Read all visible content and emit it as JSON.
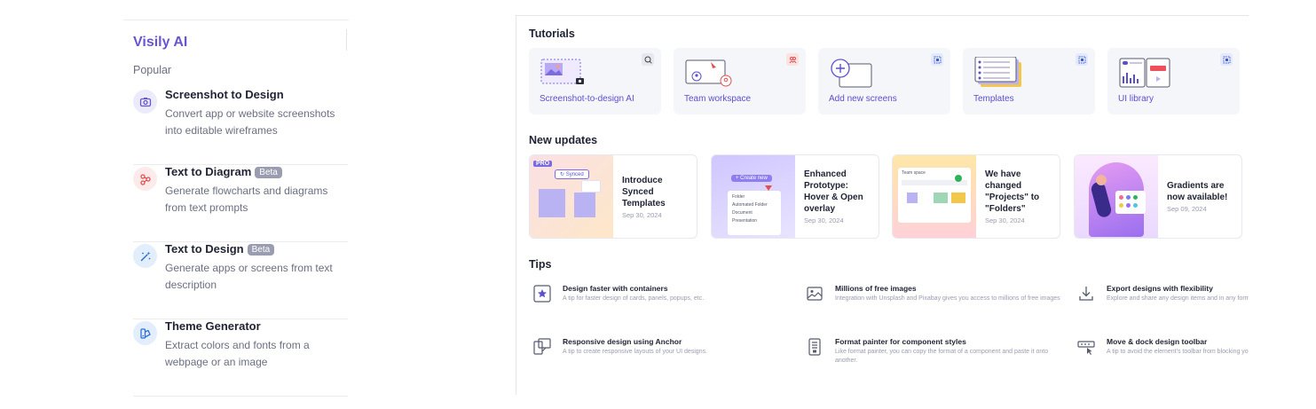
{
  "ai_panel": {
    "title": "Visily AI",
    "section": "Popular",
    "items": [
      {
        "title": "Screenshot to Design",
        "badge": "",
        "description": "Convert app or website screenshots into editable wireframes",
        "icon": "camera-icon"
      },
      {
        "title": "Text to Diagram",
        "badge": "Beta",
        "description": "Generate flowcharts and diagrams from text prompts",
        "icon": "diagram-icon"
      },
      {
        "title": "Text to Design",
        "badge": "Beta",
        "description": "Generate apps or screens from text description",
        "icon": "magic-wand-icon"
      },
      {
        "title": "Theme Generator",
        "badge": "",
        "description": "Extract colors and fonts from a webpage or an image",
        "icon": "palette-icon"
      }
    ]
  },
  "tutorials": {
    "heading": "Tutorials",
    "cards": [
      {
        "label": "Screenshot-to-design AI"
      },
      {
        "label": "Team workspace"
      },
      {
        "label": "Add new screens"
      },
      {
        "label": "Templates"
      },
      {
        "label": "UI library"
      }
    ]
  },
  "updates": {
    "heading": "New updates",
    "cards": [
      {
        "title": "Introduce Synced Templates",
        "date": "Sep 30, 2024",
        "thumb_badge": "PRO",
        "thumb_chip": "Synced"
      },
      {
        "title": "Enhanced Prototype: Hover & Open overlay",
        "date": "Sep 30, 2024",
        "thumb_button": "Create new",
        "thumb_menu": [
          "Folder",
          "Automated Folder",
          "Document",
          "Presentation"
        ]
      },
      {
        "title": "We have changed \"Projects\" to \"Folders\"",
        "date": "Sep 30, 2024",
        "thumb_header": "Team space"
      },
      {
        "title": "Gradients are now available!",
        "date": "Sep 09, 2024"
      }
    ]
  },
  "tips": {
    "heading": "Tips",
    "items": [
      {
        "title": "Design faster with containers",
        "description": "A tip for faster design of cards, panels, popups, etc.",
        "icon": "star-frame-icon"
      },
      {
        "title": "Millions of free images",
        "description": "Integration with Unsplash and Pixabay gives you access to millions of free images",
        "icon": "image-icon"
      },
      {
        "title": "Export designs with flexibility",
        "description": "Explore and share any design items and in any format",
        "icon": "download-icon"
      },
      {
        "title": "Responsive design using Anchor",
        "description": "A tip to create responsive layouts of your UI designs.",
        "icon": "anchor-icon"
      },
      {
        "title": "Format painter for component styles",
        "description": "Like format painter, you can copy the format of a component and paste it onto another.",
        "icon": "format-painter-icon"
      },
      {
        "title": "Move & dock design toolbar",
        "description": "A tip to avoid the element's toolbar from blocking your view",
        "icon": "toolbar-icon"
      }
    ]
  },
  "colors": {
    "accent": "#6a55d0",
    "link": "#5b4fd0",
    "muted": "#6b6f80",
    "beta_badge": "#9a9cb0"
  }
}
